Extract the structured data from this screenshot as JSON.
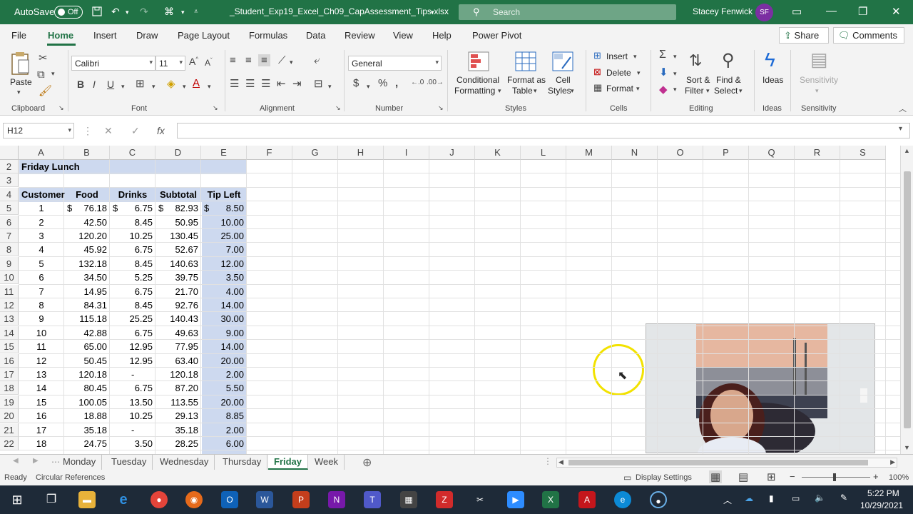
{
  "titlebar": {
    "autosave_label": "AutoSave",
    "autosave_state": "Off",
    "filename": "_Student_Exp19_Excel_Ch09_CapAssessment_Tips.xlsx",
    "search_placeholder": "Search",
    "user_name": "Stacey Fenwick",
    "user_initials": "SF"
  },
  "menu": {
    "tabs": [
      "File",
      "Home",
      "Insert",
      "Draw",
      "Page Layout",
      "Formulas",
      "Data",
      "Review",
      "View",
      "Help",
      "Power Pivot"
    ],
    "active": "Home",
    "share": "Share",
    "comments": "Comments"
  },
  "ribbon": {
    "paste": "Paste",
    "font_name": "Calibri",
    "font_size": "11",
    "number_format": "General",
    "cond_format_1": "Conditional",
    "cond_format_2": "Formatting",
    "format_table_1": "Format as",
    "format_table_2": "Table",
    "cell_styles_1": "Cell",
    "cell_styles_2": "Styles",
    "insert": "Insert",
    "delete": "Delete",
    "format": "Format",
    "sort_1": "Sort &",
    "sort_2": "Filter",
    "find_1": "Find &",
    "find_2": "Select",
    "ideas": "Ideas",
    "sensitivity": "Sensitivity",
    "groups": {
      "clipboard": "Clipboard",
      "font": "Font",
      "alignment": "Alignment",
      "number": "Number",
      "styles": "Styles",
      "cells": "Cells",
      "editing": "Editing",
      "ideas": "Ideas",
      "sensitivity": "Sensitivity"
    }
  },
  "formula_bar": {
    "name_box": "H12",
    "fx": "fx",
    "formula": ""
  },
  "grid": {
    "columns": [
      "A",
      "B",
      "C",
      "D",
      "E",
      "F",
      "G",
      "H",
      "I",
      "J",
      "K",
      "L",
      "M",
      "N",
      "O",
      "P",
      "Q",
      "R",
      "S"
    ],
    "row_numbers": [
      "2",
      "3",
      "4",
      "5",
      "6",
      "7",
      "8",
      "9",
      "10",
      "11",
      "12",
      "13",
      "14",
      "15",
      "16",
      "17",
      "18",
      "19",
      "20",
      "21",
      "22"
    ],
    "title": "Friday Lunch",
    "headers": [
      "Customer",
      "Food",
      "Drinks",
      "Subtotal",
      "Tip Left"
    ],
    "currency_symbol": "$",
    "rows": [
      [
        "1",
        "76.18",
        "6.75",
        "82.93",
        "8.50"
      ],
      [
        "2",
        "42.50",
        "8.45",
        "50.95",
        "10.00"
      ],
      [
        "3",
        "120.20",
        "10.25",
        "130.45",
        "25.00"
      ],
      [
        "4",
        "45.92",
        "6.75",
        "52.67",
        "7.00"
      ],
      [
        "5",
        "132.18",
        "8.45",
        "140.63",
        "12.00"
      ],
      [
        "6",
        "34.50",
        "5.25",
        "39.75",
        "3.50"
      ],
      [
        "7",
        "14.95",
        "6.75",
        "21.70",
        "4.00"
      ],
      [
        "8",
        "84.31",
        "8.45",
        "92.76",
        "14.00"
      ],
      [
        "9",
        "115.18",
        "25.25",
        "140.43",
        "30.00"
      ],
      [
        "10",
        "42.88",
        "6.75",
        "49.63",
        "9.00"
      ],
      [
        "11",
        "65.00",
        "12.95",
        "77.95",
        "14.00"
      ],
      [
        "12",
        "50.45",
        "12.95",
        "63.40",
        "20.00"
      ],
      [
        "13",
        "120.18",
        "-",
        "120.18",
        "2.00"
      ],
      [
        "14",
        "80.45",
        "6.75",
        "87.20",
        "5.50"
      ],
      [
        "15",
        "100.05",
        "13.50",
        "113.55",
        "20.00"
      ],
      [
        "16",
        "18.88",
        "10.25",
        "29.13",
        "8.85"
      ],
      [
        "17",
        "35.18",
        "-",
        "35.18",
        "2.00"
      ],
      [
        "18",
        "24.75",
        "3.50",
        "28.25",
        "6.00"
      ]
    ]
  },
  "sheet_tabs": [
    "Monday",
    "Tuesday",
    "Wednesday",
    "Thursday",
    "Friday",
    "Week"
  ],
  "active_sheet": "Friday",
  "status": {
    "ready": "Ready",
    "circular": "Circular References",
    "display_settings": "Display Settings",
    "zoom": "100%"
  },
  "taskbar": {
    "time": "5:22 PM",
    "date": "10/29/2021"
  },
  "colors": {
    "excel_green": "#217346",
    "table_band": "#cdd9ef",
    "highlight_ring": "#f2e200"
  }
}
